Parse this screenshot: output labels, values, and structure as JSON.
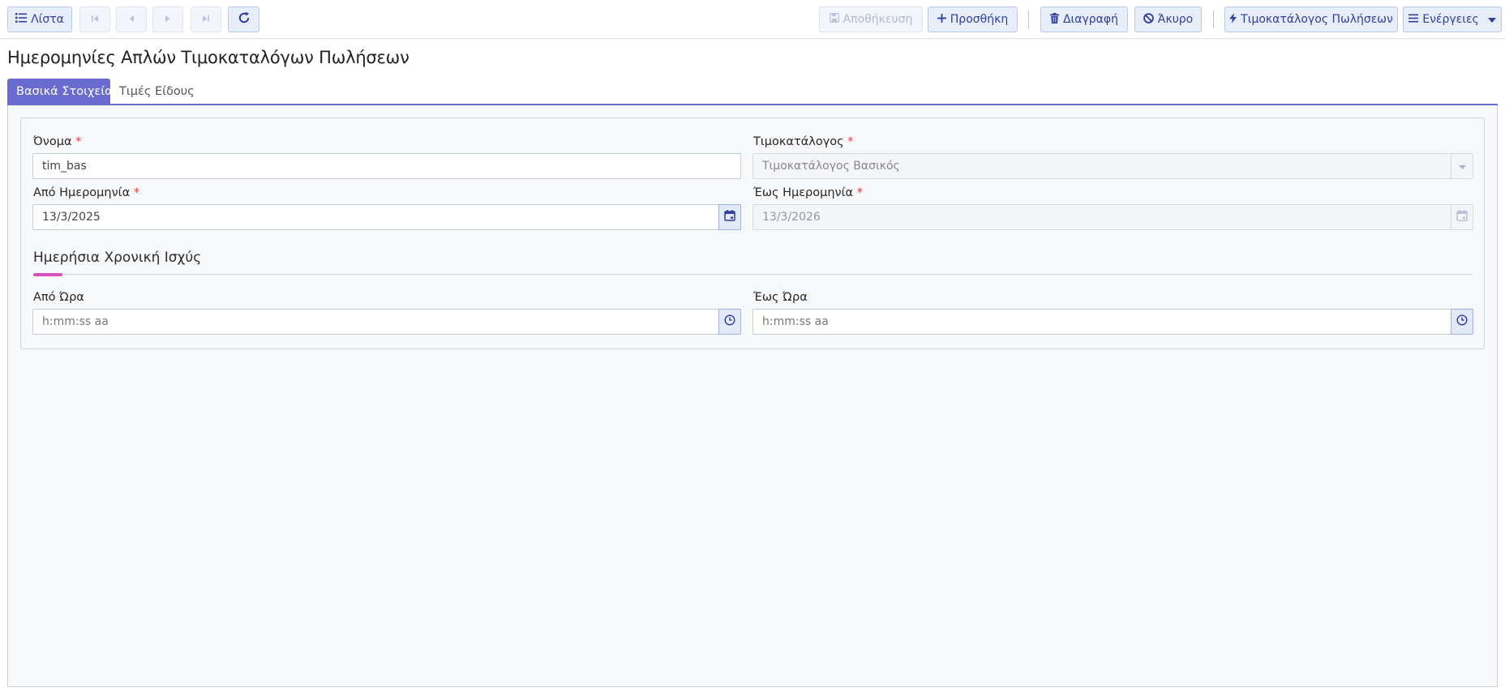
{
  "toolbar": {
    "list_label": "Λίστα",
    "save_label": "Αποθήκευση",
    "add_label": "Προσθήκη",
    "delete_label": "Διαγραφή",
    "cancel_label": "Άκυρο",
    "pricelist_label": "Τιμοκατάλογος Πωλήσεων",
    "actions_label": "Ενέργειες"
  },
  "page": {
    "title": "Ημερομηνίες Απλών Τιμοκαταλόγων Πωλήσεων"
  },
  "tabs": [
    {
      "label": "Βασικά Στοιχεία",
      "active": true
    },
    {
      "label": "Τιμές Είδους",
      "active": false
    }
  ],
  "form": {
    "name": {
      "label": "Όνομα",
      "required_mark": "*",
      "value": "tim_bas"
    },
    "pricelist": {
      "label": "Τιμοκατάλογος",
      "required_mark": "*",
      "value": "Τιμοκατάλογος Βασικός"
    },
    "from_date": {
      "label": "Από Ημερομηνία",
      "required_mark": "*",
      "value": "13/3/2025"
    },
    "to_date": {
      "label": "Έως Ημερομηνία",
      "required_mark": "*",
      "value": "13/3/2026"
    },
    "section_title": "Ημερήσια Χρονική Ισχύς",
    "from_time": {
      "label": "Από Ώρα",
      "placeholder": "h:mm:ss aa"
    },
    "to_time": {
      "label": "Έως Ώρα",
      "placeholder": "h:mm:ss aa"
    }
  },
  "icons": {
    "list": "list-icon",
    "first": "first-page-icon",
    "prev": "previous-icon",
    "next": "next-icon",
    "last": "last-page-icon",
    "refresh": "refresh-icon",
    "save": "save-icon",
    "add": "plus-icon",
    "delete": "trash-icon",
    "cancel": "ban-icon",
    "pricelist": "bolt-icon",
    "actions": "menu-icon",
    "calendar": "calendar-icon",
    "clock": "clock-icon",
    "dropdown": "caret-down-icon"
  },
  "colors": {
    "accent": "#6a6bd0",
    "button_bg": "#e7eefa",
    "button_text": "#2f3f9a",
    "section_accent": "#d94fbd",
    "required": "#e03a3a"
  }
}
